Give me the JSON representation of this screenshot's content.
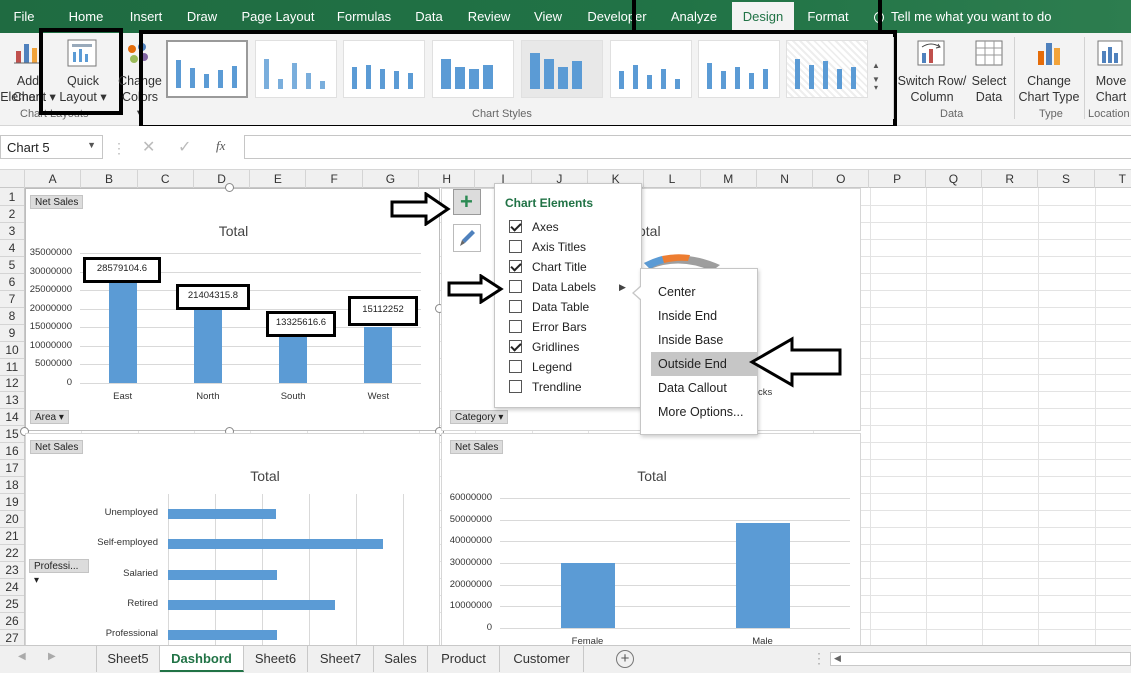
{
  "menu": {
    "tabs": [
      "File",
      "Home",
      "Insert",
      "Draw",
      "Page Layout",
      "Formulas",
      "Data",
      "Review",
      "View",
      "Developer",
      "Analyze",
      "Design",
      "Format"
    ],
    "tell_me": "Tell me what you want to do"
  },
  "ribbon": {
    "add_chart_element": [
      "Add Chart",
      "Element ▾"
    ],
    "quick_layout": [
      "Quick",
      "Layout ▾"
    ],
    "change_colors": [
      "Change",
      "Colors ▾"
    ],
    "chart_layouts_group": "Chart Layouts",
    "chart_styles_group": "Chart Styles",
    "switch_row_col": [
      "Switch Row/",
      "Column"
    ],
    "select_data": [
      "Select",
      "Data"
    ],
    "data_group": "Data",
    "change_chart_type": [
      "Change",
      "Chart Type"
    ],
    "type_group": "Type",
    "move_chart": [
      "Move",
      "Chart"
    ],
    "location_group": "Location"
  },
  "formula_bar": {
    "name_box": "Chart 5",
    "fx": "fx",
    "value": ""
  },
  "columns": [
    "A",
    "B",
    "C",
    "D",
    "E",
    "F",
    "G",
    "H",
    "I",
    "J",
    "K",
    "L",
    "M",
    "N",
    "O",
    "P",
    "Q",
    "R",
    "S",
    "T"
  ],
  "rows": [
    "1",
    "2",
    "3",
    "4",
    "5",
    "6",
    "7",
    "8",
    "9",
    "10",
    "11",
    "12",
    "13",
    "14",
    "15",
    "16",
    "17",
    "18",
    "19",
    "20",
    "21",
    "22",
    "23",
    "24",
    "25",
    "26",
    "27"
  ],
  "charts": {
    "c1": {
      "field_btn": "Net Sales",
      "axis_btn": "Area ▾",
      "title": "Total"
    },
    "c2": {
      "field_btn": "Net Sales",
      "axis_btn": "Category ▾",
      "title_partial": "otal",
      "legend_partial": "cks"
    },
    "c3": {
      "field_btn": "Net Sales",
      "axis_btn": "Professi... ▾",
      "title": "Total"
    },
    "c4": {
      "field_btn": "Net Sales",
      "title": "Total"
    }
  },
  "chart_data": [
    {
      "type": "bar",
      "title": "Total",
      "categories": [
        "East",
        "North",
        "South",
        "West"
      ],
      "values": [
        28579104.6,
        21404315.8,
        13325616.6,
        15112252
      ],
      "data_labels": [
        "28579104.6",
        "21404315.8",
        "13325616.6",
        "15112252"
      ],
      "yticks": [
        "35000000",
        "30000000",
        "25000000",
        "20000000",
        "15000000",
        "10000000",
        "5000000",
        "0"
      ],
      "ylim": [
        0,
        35000000
      ],
      "grid": true
    },
    {
      "type": "bar",
      "orientation": "horizontal",
      "title": "Total",
      "categories": [
        "Unemployed",
        "Self-employed",
        "Salaried",
        "Retired",
        "Professional"
      ],
      "values": [
        11500000,
        22900000,
        11600000,
        17800000,
        11600000
      ],
      "grid": true
    },
    {
      "type": "bar",
      "title": "Total",
      "categories": [
        "Female",
        "Male"
      ],
      "values": [
        30200000,
        48300000
      ],
      "yticks": [
        "60000000",
        "50000000",
        "40000000",
        "30000000",
        "20000000",
        "10000000",
        "0"
      ],
      "ylim": [
        0,
        60000000
      ],
      "grid": true
    }
  ],
  "chart_elements": {
    "title": "Chart Elements",
    "items": [
      {
        "label": "Axes",
        "checked": true
      },
      {
        "label": "Axis Titles",
        "checked": false
      },
      {
        "label": "Chart Title",
        "checked": true
      },
      {
        "label": "Data Labels",
        "checked": false
      },
      {
        "label": "Data Table",
        "checked": false
      },
      {
        "label": "Error Bars",
        "checked": false
      },
      {
        "label": "Gridlines",
        "checked": true
      },
      {
        "label": "Legend",
        "checked": false
      },
      {
        "label": "Trendline",
        "checked": false
      }
    ]
  },
  "data_labels_menu": [
    "Center",
    "Inside End",
    "Inside Base",
    "Outside End",
    "Data Callout",
    "More Options..."
  ],
  "sheets": [
    "Sheet5",
    "Dashbord",
    "Sheet6",
    "Sheet7",
    "Sales",
    "Product",
    "Customer"
  ],
  "colors": {
    "excel_green": "#217346",
    "bar_blue": "#5b9bd5",
    "ribbon_bg": "#f3f3f3"
  }
}
